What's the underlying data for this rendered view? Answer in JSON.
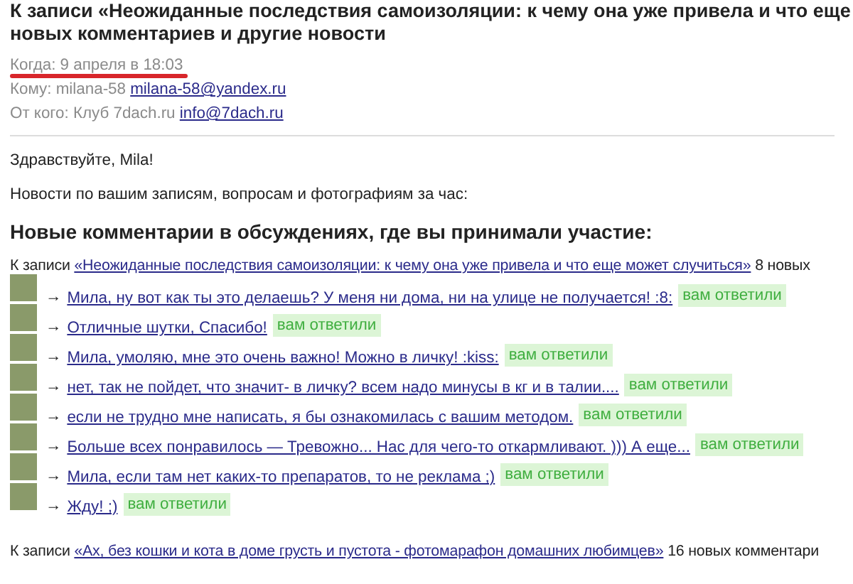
{
  "subject": {
    "line_1": "К записи «Неожиданные последствия самоизоляции: к чему она уже привела и что еще",
    "line_2": "новых комментариев и другие новости"
  },
  "meta": {
    "when": "Когда: 9 апреля в 18:03",
    "to_label": "Кому: milana-58",
    "to_email": "milana-58@yandex.ru",
    "from_label": "От кого: Клуб 7dach.ru",
    "from_email": "info@7dach.ru"
  },
  "greeting": "Здравствуйте, Mila!",
  "intro": "Новости по вашим записям, вопросам и фотографиям за час:",
  "section_title": "Новые комментарии в обсуждениях, где вы принимали участие:",
  "posts": [
    {
      "prefix": "К записи",
      "title": "«Неожиданные последствия самоизоляции: к чему она уже привела и что еще может случиться»",
      "count": "8 новых",
      "comments": [
        {
          "arrow": "→",
          "text": "Мила, ну вот как ты это делаешь? У меня ни дома, ни на улице не получается! :8:",
          "badge": "вам ответили"
        },
        {
          "arrow": "→",
          "text": "Отличные шутки, Спасибо!",
          "badge": "вам ответили"
        },
        {
          "arrow": "→",
          "text": "Мила, умоляю, мне это очень важно! Можно в личку! :kiss:",
          "badge": "вам ответили"
        },
        {
          "arrow": "→",
          "text": "нет, так не пойдет, что значит- в личку? всем надо минусы в кг и в талии....",
          "badge": "вам ответили"
        },
        {
          "arrow": "→",
          "text": "если не трудно мне написать, я бы ознакомилась с вашим методом.",
          "badge": "вам ответили"
        },
        {
          "arrow": "→",
          "text": "Больше всех понравилось — Тревожно... Нас для чего-то откармливают. ))) А еще...",
          "badge": "вам ответили"
        },
        {
          "arrow": "→",
          "text": "Мила, если там нет каких-то препаратов, то не реклама ;)",
          "badge": "вам ответили"
        },
        {
          "arrow": "→",
          "text": "Жду! ;)",
          "badge": "вам ответили"
        }
      ]
    },
    {
      "prefix": "К записи",
      "title": "«Ах, без кошки и кота в доме грусть и пустота - фотомарафон домашних любимцев»",
      "count": "16 новых комментари"
    }
  ]
}
